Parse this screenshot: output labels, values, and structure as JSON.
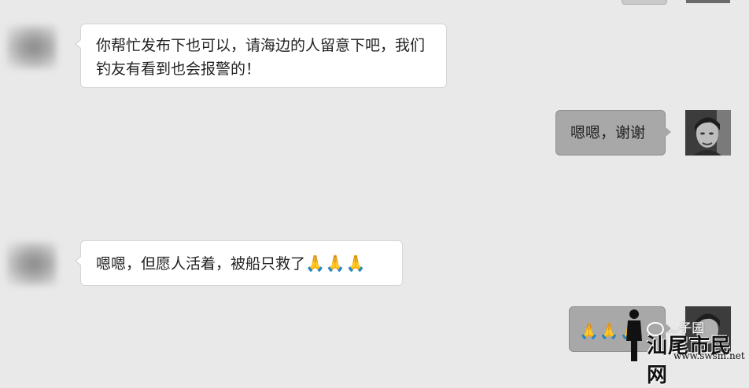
{
  "messages": [
    {
      "side": "received",
      "text": "你帮忙发布下也可以，请海边的人留意下吧，我们钓友有看到也会报警的！"
    },
    {
      "side": "sent",
      "text": "嗯嗯，谢谢"
    },
    {
      "side": "received",
      "text": "嗯嗯，但愿人活着，被船只救了",
      "emoji": "🙏🙏🙏"
    },
    {
      "side": "sent",
      "emoji": "🙏🙏🙏"
    }
  ],
  "watermark": {
    "wechat_label": "...子园",
    "site_name": "汕尾市民网",
    "site_url": "www.swsm.net"
  },
  "icons": {
    "pray": "folded-hands-emoji",
    "wechat": "wechat-icon"
  },
  "colors": {
    "background": "#e9e9e9",
    "received_bubble": "#ffffff",
    "sent_bubble": "#a8a8a8"
  }
}
